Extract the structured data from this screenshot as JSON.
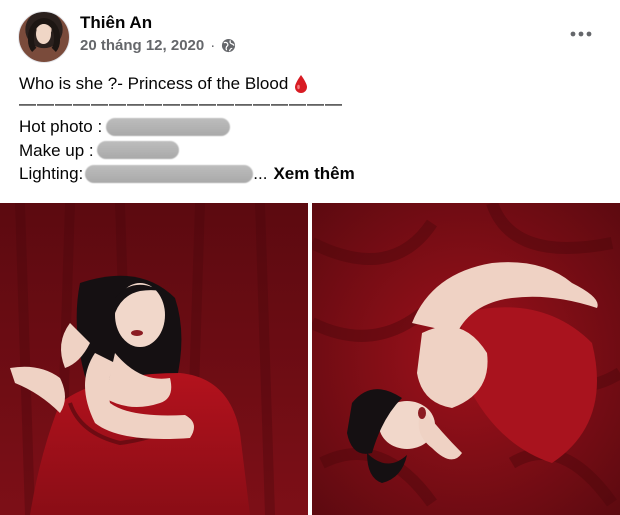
{
  "post": {
    "author": "Thiên An",
    "timestamp": "20 tháng 12, 2020",
    "separator": "·",
    "audience_icon": "globe-icon",
    "more_icon": "ellipsis-icon"
  },
  "content": {
    "line1": "Who is she ?- Princess of the Blood",
    "line1_icon": "blood-drop-icon",
    "divider": "——————————————————",
    "hot_photo_label": "Hot photo :",
    "makeup_label": "Make up :",
    "lighting_label": "Lighting:",
    "ellipsis": "...",
    "see_more": "Xem thêm"
  },
  "colors": {
    "text": "#050505",
    "meta": "#65676b",
    "dress_red": "#8b0f18",
    "blood_drop": "#d81b23"
  },
  "photos": [
    {
      "name": "photo-left",
      "description_icon": "photo"
    },
    {
      "name": "photo-right",
      "description_icon": "photo"
    }
  ]
}
